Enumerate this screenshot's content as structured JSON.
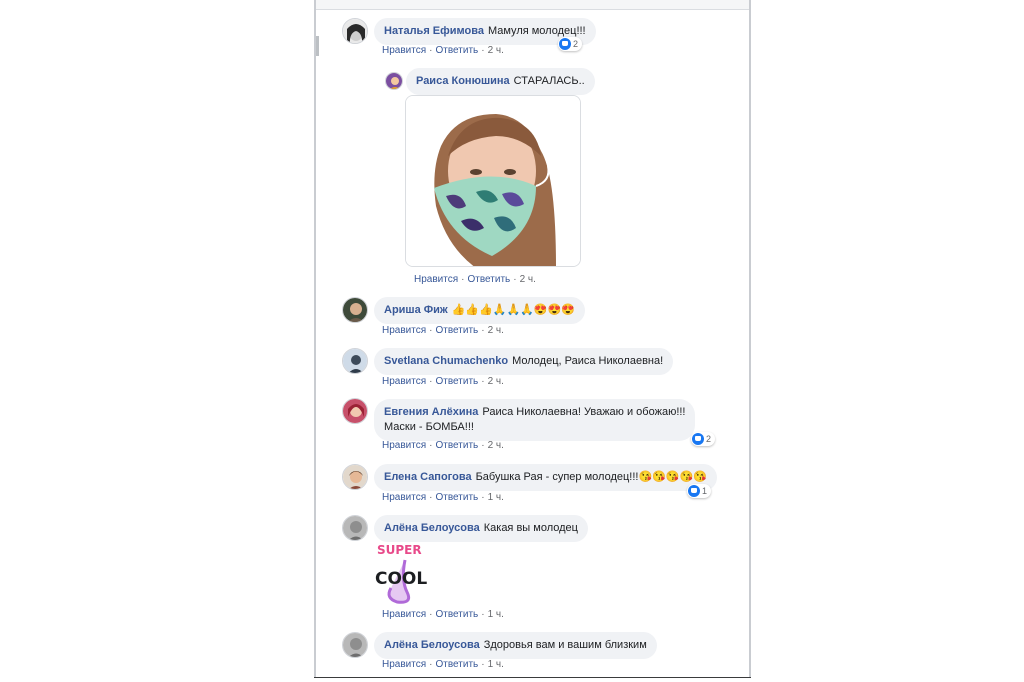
{
  "comments": [
    {
      "name": "Наталья Ефимова",
      "text": "Мамуля молодец!!!",
      "like": "Нравится",
      "reply": "Ответить",
      "time": "2 ч.",
      "reactions": "2"
    },
    {
      "name": "Раиса Конюшина",
      "text": "СТАРАЛАСЬ..",
      "like": "Нравится",
      "reply": "Ответить",
      "time": "2 ч."
    },
    {
      "name": "Ариша Фиж",
      "text": "👍👍👍🙏🙏🙏😍😍😍",
      "like": "Нравится",
      "reply": "Ответить",
      "time": "2 ч."
    },
    {
      "name": "Svetlana Chumachenko",
      "text": "Молодец, Раиса Николаевна!",
      "like": "Нравится",
      "reply": "Ответить",
      "time": "2 ч."
    },
    {
      "name": "Евгения Алёхина",
      "text": "Раиса Николаевна! Уважаю и обожаю!!!",
      "text2": "Маски - БОМБА!!!",
      "like": "Нравится",
      "reply": "Ответить",
      "time": "2 ч.",
      "reactions": "2"
    },
    {
      "name": "Елена Сапогова",
      "text": "Бабушка Рая - супер молодец!!!😘😘😘😘😘",
      "like": "Нравится",
      "reply": "Ответить",
      "time": "1 ч.",
      "reactions": "1"
    },
    {
      "name": "Алёна Белоусова",
      "text": "Какая вы молодец",
      "like": "Нравится",
      "reply": "Ответить",
      "time": "1 ч."
    },
    {
      "name": "Алёна Белоусова",
      "text": "Здоровья вам и вашим близким",
      "like": "Нравится",
      "reply": "Ответить",
      "time": "1 ч."
    }
  ],
  "sticker": {
    "top": "SUPER",
    "bottom": "COOL"
  },
  "colors": {
    "name": "#385898",
    "bubble": "#f0f2f5",
    "like": "#1877f2"
  }
}
